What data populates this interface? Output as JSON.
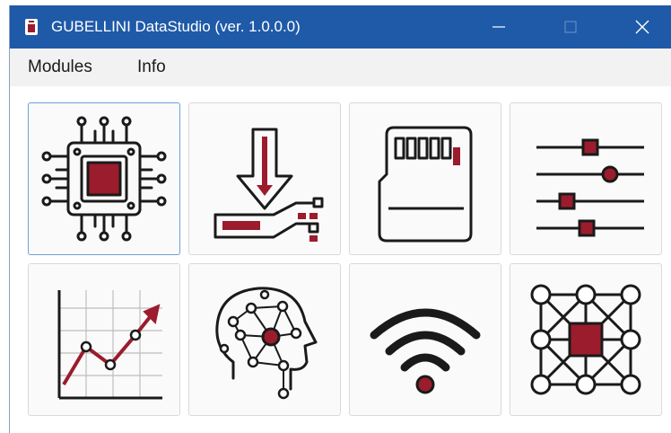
{
  "window": {
    "title": "GUBELLINI DataStudio (ver. 1.0.0.0)",
    "controls": [
      {
        "name": "minimize-button",
        "icon": "minimize-icon"
      },
      {
        "name": "maximize-button",
        "icon": "maximize-icon"
      },
      {
        "name": "close-button",
        "icon": "close-icon"
      }
    ]
  },
  "menu": {
    "modules": "Modules",
    "info": "Info"
  },
  "colors": {
    "titlebar": "#1f5aa8",
    "accent": "#9b1c2c",
    "outline": "#1a1a1a"
  },
  "modules": [
    {
      "icon": "microchip-icon"
    },
    {
      "icon": "download-to-device-icon"
    },
    {
      "icon": "sd-card-icon"
    },
    {
      "icon": "sliders-icon"
    },
    {
      "icon": "trend-chart-icon"
    },
    {
      "icon": "ai-head-icon"
    },
    {
      "icon": "wifi-icon"
    },
    {
      "icon": "network-grid-icon"
    }
  ]
}
